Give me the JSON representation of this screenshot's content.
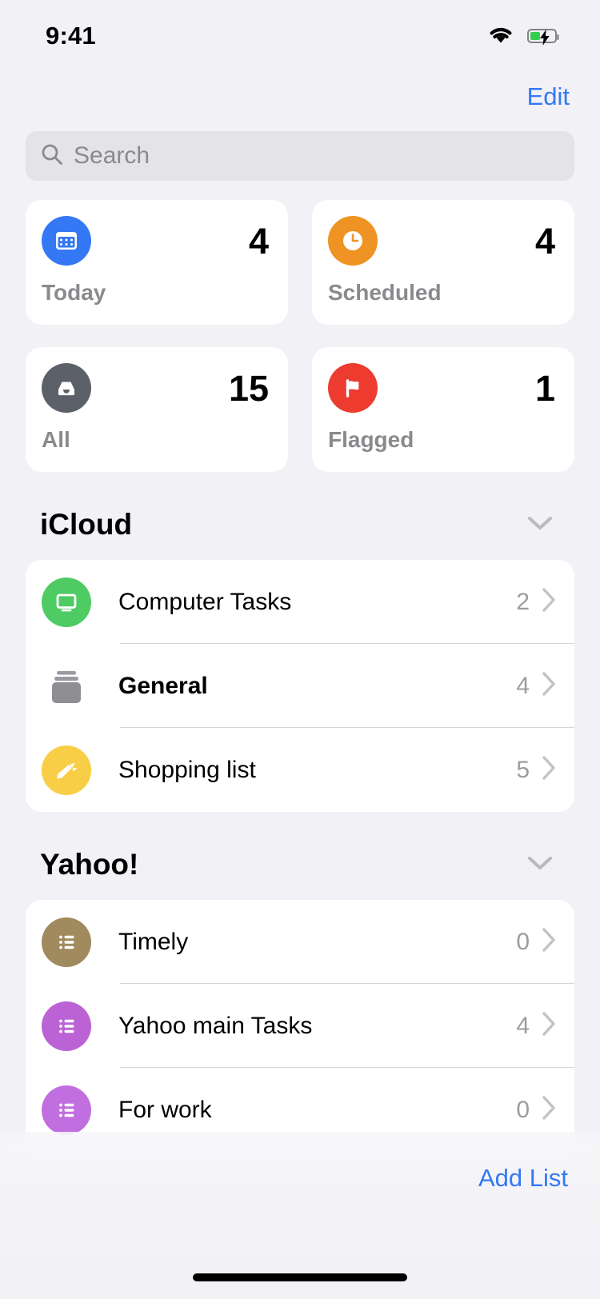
{
  "status_bar": {
    "time": "9:41",
    "wifi_icon": "wifi-icon",
    "battery_icon": "battery-charging-icon",
    "battery_color": "#31cf4b"
  },
  "navbar": {
    "edit_label": "Edit",
    "accent_color": "#3478f6"
  },
  "search": {
    "placeholder": "Search",
    "value": "",
    "icon": "search-icon",
    "background": "#e3e3e8"
  },
  "smart_lists": [
    {
      "label": "Today",
      "count": "4",
      "icon": "calendar-icon",
      "color": "#3478f6"
    },
    {
      "label": "Scheduled",
      "count": "4",
      "icon": "clock-icon",
      "color": "#ef9324"
    },
    {
      "label": "All",
      "count": "15",
      "icon": "inbox-icon",
      "color": "#5c6069"
    },
    {
      "label": "Flagged",
      "count": "1",
      "icon": "flag-icon",
      "color": "#ee3b30"
    }
  ],
  "sections": [
    {
      "title": "iCloud",
      "collapse_icon": "chevron-down-icon",
      "rows": [
        {
          "title": "Computer Tasks",
          "count": "2",
          "icon": "display-icon",
          "color": "#4ecb62",
          "bold": false
        },
        {
          "title": "General",
          "count": "4",
          "icon": "group-stack-icon",
          "color": "#8e8e93",
          "bold": true
        },
        {
          "title": "Shopping list",
          "count": "5",
          "icon": "carrot-icon",
          "color": "#f7ce46",
          "bold": false
        }
      ]
    },
    {
      "title": "Yahoo!",
      "collapse_icon": "chevron-down-icon",
      "rows": [
        {
          "title": "Timely",
          "count": "0",
          "icon": "list-bullet-icon",
          "color": "#a08a5e",
          "bold": false
        },
        {
          "title": "Yahoo main Tasks",
          "count": "4",
          "icon": "list-bullet-icon",
          "color": "#bb63d4",
          "bold": false
        },
        {
          "title": "For work",
          "count": "0",
          "icon": "list-bullet-icon",
          "color": "#c06ee0",
          "bold": false
        }
      ]
    }
  ],
  "bottom_bar": {
    "add_list_label": "Add List",
    "accent_color": "#3478f6"
  }
}
